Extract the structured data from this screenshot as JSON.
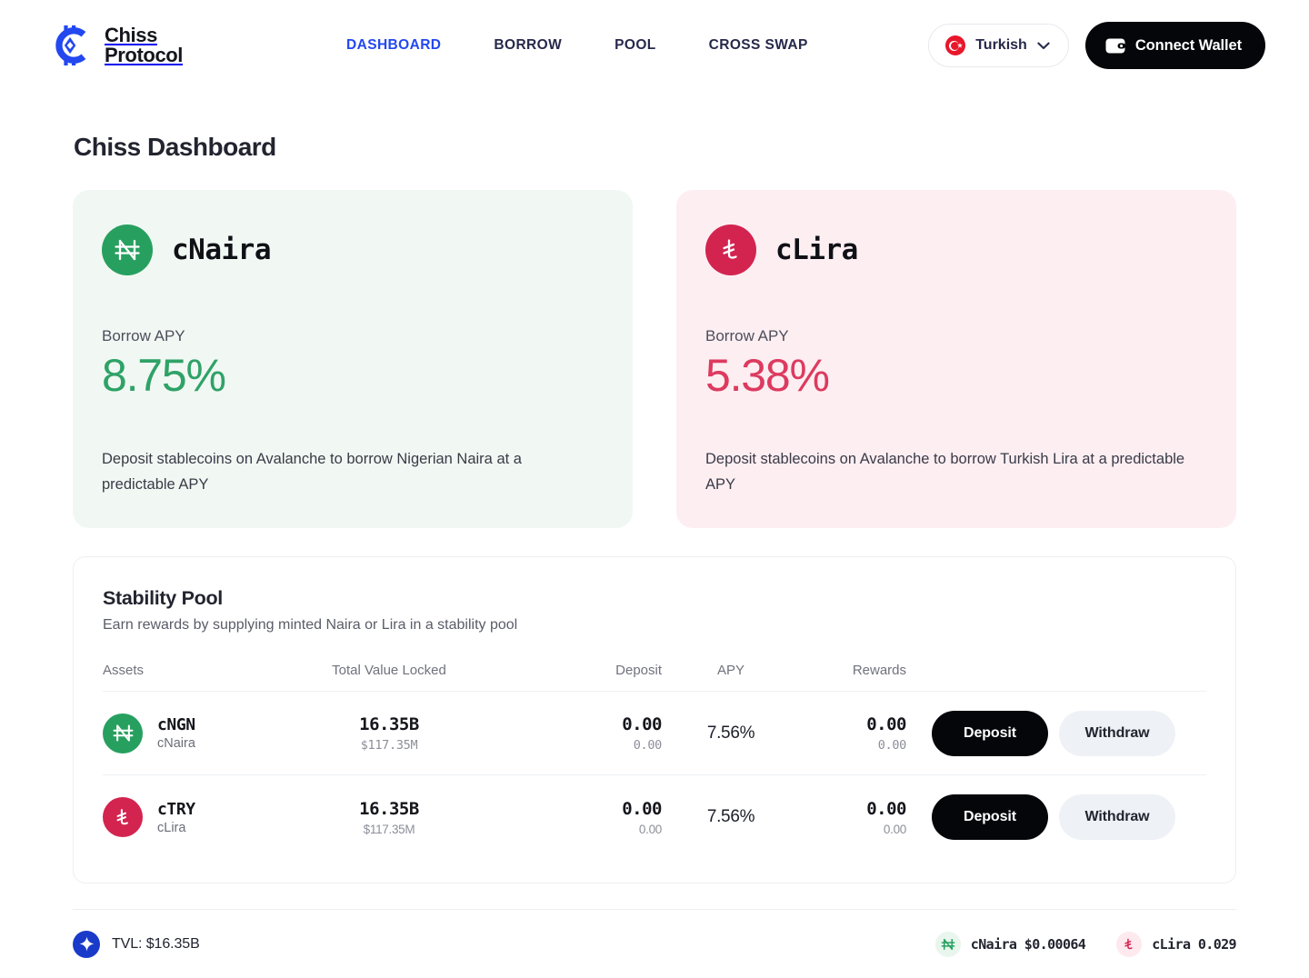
{
  "brand": {
    "line1": "Chiss",
    "line2": "Protocol",
    "logo_icon": "chiss-logo-icon",
    "color": "#2348f0"
  },
  "nav": {
    "items": [
      {
        "label": "DASHBOARD",
        "active": true
      },
      {
        "label": "BORROW",
        "active": false
      },
      {
        "label": "POOL",
        "active": false
      },
      {
        "label": "CROSS SWAP",
        "active": false
      }
    ]
  },
  "header": {
    "language": {
      "label": "Turkish",
      "flag_icon": "turkish-flag-icon",
      "chevron_icon": "chevron-down-icon"
    },
    "wallet_button": {
      "label": "Connect Wallet",
      "icon": "wallet-icon"
    }
  },
  "main": {
    "page_title": "Chiss Dashboard",
    "cards": [
      {
        "id": "cnaira",
        "title": "cNaira",
        "icon": "naira-symbol-icon",
        "apy_label": "Borrow APY",
        "apy_value": "8.75%",
        "description": "Deposit stablecoins on Avalanche to borrow Nigerian Naira at a predictable APY",
        "accent": "#2fa267",
        "bg": "#f1f8f3"
      },
      {
        "id": "clira",
        "title": "cLira",
        "icon": "lira-symbol-icon",
        "apy_label": "Borrow APY",
        "apy_value": "5.38%",
        "description": "Deposit stablecoins on Avalanche to borrow Turkish Lira at a predictable APY",
        "accent": "#dd3a5f",
        "bg": "#fdeef2"
      }
    ],
    "pool": {
      "title": "Stability Pool",
      "subtitle": "Earn rewards by supplying minted Naira or Lira in a stability pool",
      "columns": [
        "Assets",
        "Total Value Locked",
        "Deposit",
        "APY",
        "Rewards"
      ],
      "rows": [
        {
          "symbol": "cNGN",
          "name": "cNaira",
          "icon": "naira-symbol-icon",
          "tvl": "16.35B",
          "tvl_usd": "$117.35M",
          "deposit": "0.00",
          "deposit_sub": "0.00",
          "apy": "7.56%",
          "rewards": "0.00",
          "rewards_sub": "0.00",
          "deposit_button": "Deposit",
          "withdraw_button": "Withdraw"
        },
        {
          "symbol": "cTRY",
          "name": "cLira",
          "icon": "lira-symbol-icon",
          "tvl": "16.35B",
          "tvl_usd": "$117.35M",
          "deposit": "0.00",
          "deposit_sub": "0.00",
          "apy": "7.56%",
          "rewards": "0.00",
          "rewards_sub": "0.00",
          "deposit_button": "Deposit",
          "withdraw_button": "Withdraw"
        }
      ]
    }
  },
  "footer": {
    "tvl_text": "TVL: $16.35B",
    "tvl_icon": "diamond-star-icon",
    "tickers": [
      {
        "label": "cNaira $0.00064",
        "icon": "naira-symbol-icon"
      },
      {
        "label": "cLira 0.029",
        "icon": "lira-symbol-icon"
      }
    ]
  }
}
